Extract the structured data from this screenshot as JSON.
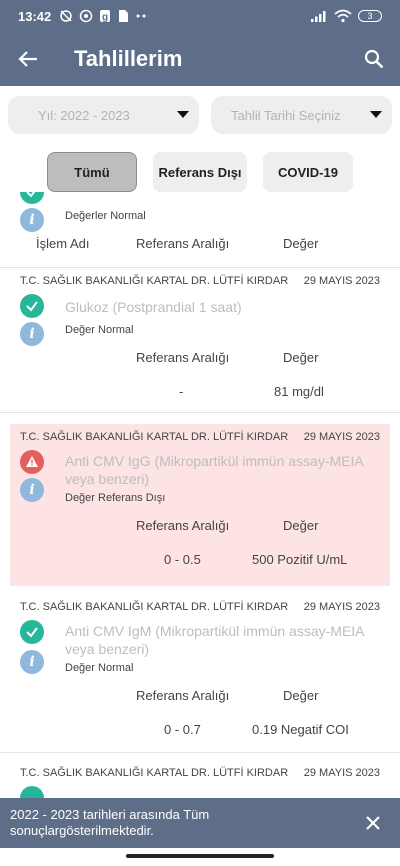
{
  "status_bar": {
    "time": "13:42",
    "left_icons": [
      "alarm-off-icon",
      "whatsapp-icon",
      "g-icon",
      "sim-icon",
      "more-icon"
    ],
    "right_icons": [
      "signal-icon",
      "wifi-icon"
    ],
    "battery": "3"
  },
  "app_bar": {
    "title": "Tahlillerim",
    "back_icon": "arrow-left-icon",
    "search_icon": "search-icon"
  },
  "filters": {
    "year": "Yıl: 2022 - 2023",
    "date_placeholder": "Tahlil Tarihi Seçiniz"
  },
  "tabs": [
    {
      "label": "Tümü",
      "active": true
    },
    {
      "label": "Referans Dışı",
      "active": false
    },
    {
      "label": "COVID-19",
      "active": false
    }
  ],
  "columns": {
    "islem": "İşlem Adı",
    "referans": "Referans Aralığı",
    "deger": "Değer"
  },
  "partial_record": {
    "status": "Değerler Normal"
  },
  "records": [
    {
      "hospital": "T.C. SAĞLIK BAKANLIĞI KARTAL DR. LÜTFİ KIRDAR",
      "date": "29 MAYIS 2023",
      "test": "Glukoz (Postprandial 1 saat)",
      "status": "Değer Normal",
      "reference": "-",
      "value": "81 mg/dl",
      "out_of_range": false
    },
    {
      "hospital": "T.C. SAĞLIK BAKANLIĞI KARTAL DR. LÜTFİ KIRDAR",
      "date": "29 MAYIS 2023",
      "test": "Anti CMV IgG (Mikropartikül immün assay-MEIA veya benzeri)",
      "status": "Değer Referans Dışı",
      "reference": "0 - 0.5",
      "value": "500 Pozitif U/mL",
      "out_of_range": true
    },
    {
      "hospital": "T.C. SAĞLIK BAKANLIĞI KARTAL DR. LÜTFİ KIRDAR",
      "date": "29 MAYIS 2023",
      "test": "Anti CMV IgM (Mikropartikül immün assay-MEIA veya benzeri)",
      "status": "Değer Normal",
      "reference": "0 - 0.7",
      "value": "0.19 Negatif COI",
      "out_of_range": false
    },
    {
      "hospital": "T.C. SAĞLIK BAKANLIĞI KARTAL DR. LÜTFİ KIRDAR",
      "date": "29 MAYIS 2023"
    }
  ],
  "snackbar": {
    "message": "2022 - 2023 tarihleri arasında Tüm sonuçlargösterilmektedir.",
    "close_icon": "close-icon"
  },
  "colors": {
    "primary": "#5e6e88",
    "success": "#26b69a",
    "info": "#8fb8dc",
    "danger": "#e26060",
    "danger_bg": "#fde3e3"
  }
}
